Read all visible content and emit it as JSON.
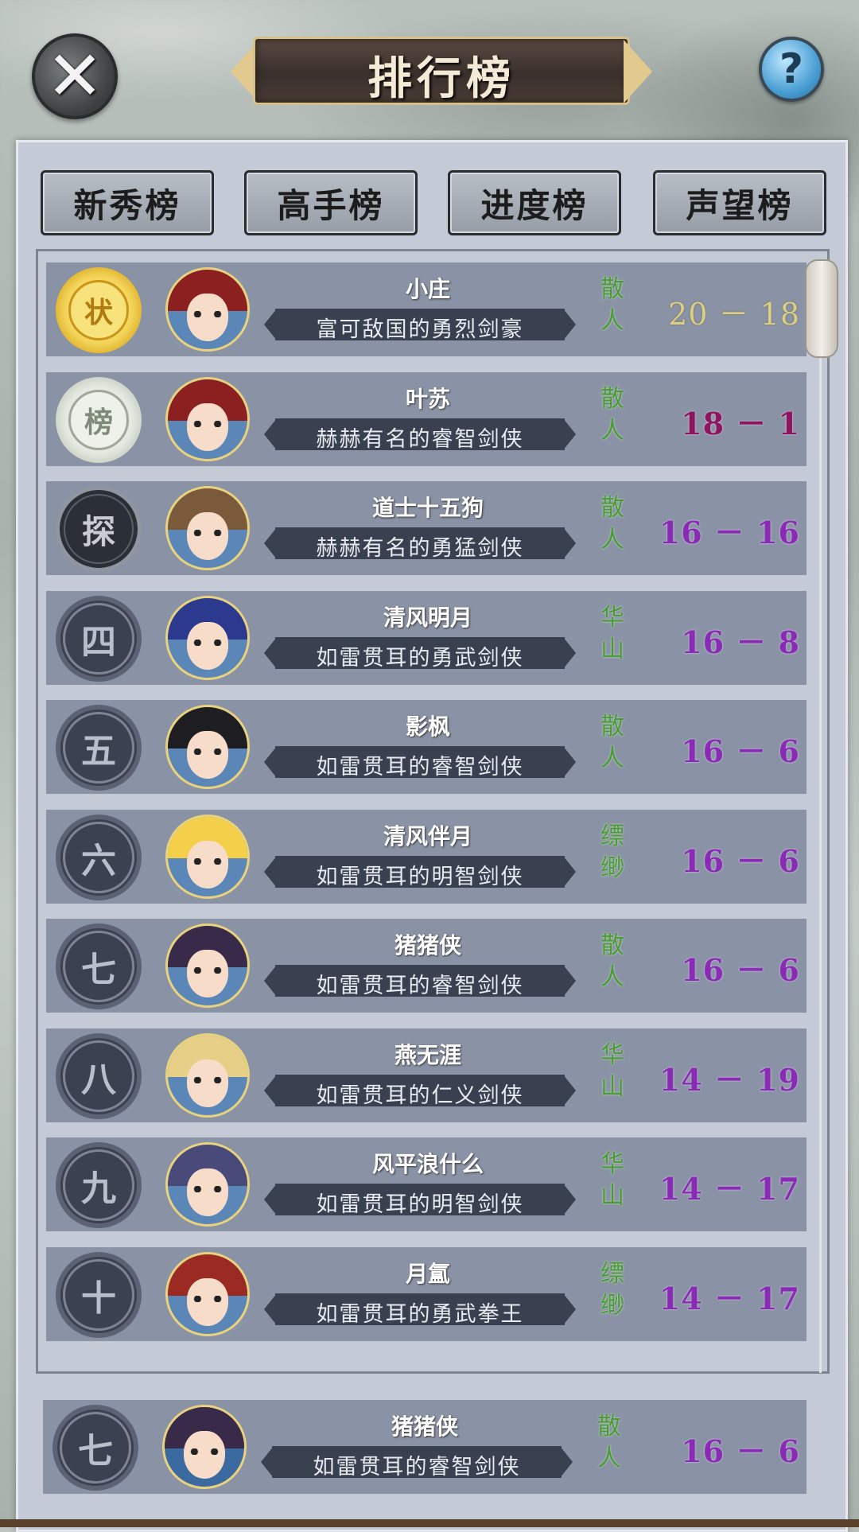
{
  "header": {
    "title": "排行榜",
    "close_icon": "close-icon",
    "help_label": "?"
  },
  "tabs": [
    {
      "label": "新秀榜"
    },
    {
      "label": "高手榜"
    },
    {
      "label": "进度榜"
    },
    {
      "label": "声望榜"
    }
  ],
  "rows": [
    {
      "rank": "状",
      "rank_style": "gold",
      "name": "小庄",
      "title": "富可敌国的勇烈剑豪",
      "faction": "散人",
      "score": "20 － 18",
      "score_style": "gold"
    },
    {
      "rank": "榜",
      "rank_style": "silver",
      "name": "叶苏",
      "title": "赫赫有名的睿智剑侠",
      "faction": "散人",
      "score": "18 － 1",
      "score_style": "crimson"
    },
    {
      "rank": "探",
      "rank_style": "dark",
      "name": "道士十五狗",
      "title": "赫赫有名的勇猛剑侠",
      "faction": "散人",
      "score": "16 － 16",
      "score_style": "purple"
    },
    {
      "rank": "四",
      "rank_style": "plain",
      "name": "清风明月",
      "title": "如雷贯耳的勇武剑侠",
      "faction": "华山",
      "score": "16 － 8",
      "score_style": "purple"
    },
    {
      "rank": "五",
      "rank_style": "plain",
      "name": "影枫",
      "title": "如雷贯耳的睿智剑侠",
      "faction": "散人",
      "score": "16 － 6",
      "score_style": "purple"
    },
    {
      "rank": "六",
      "rank_style": "plain",
      "name": "清风伴月",
      "title": "如雷贯耳的明智剑侠",
      "faction": "缥缈",
      "score": "16 － 6",
      "score_style": "purple"
    },
    {
      "rank": "七",
      "rank_style": "plain",
      "name": "猪猪侠",
      "title": "如雷贯耳的睿智剑侠",
      "faction": "散人",
      "score": "16 － 6",
      "score_style": "purple"
    },
    {
      "rank": "八",
      "rank_style": "plain",
      "name": "燕无涯",
      "title": "如雷贯耳的仁义剑侠",
      "faction": "华山",
      "score": "14 － 19",
      "score_style": "purple"
    },
    {
      "rank": "九",
      "rank_style": "plain",
      "name": "风平浪什么",
      "title": "如雷贯耳的明智剑侠",
      "faction": "华山",
      "score": "14 － 17",
      "score_style": "purple"
    },
    {
      "rank": "十",
      "rank_style": "plain",
      "name": "月氲",
      "title": "如雷贯耳的勇武拳王",
      "faction": "缥缈",
      "score": "14 － 17",
      "score_style": "purple"
    }
  ],
  "self_row": {
    "rank": "七",
    "name": "猪猪侠",
    "title": "如雷贯耳的睿智剑侠",
    "faction": "散人",
    "score": "16 － 6"
  },
  "avatar_colors": [
    "#8c1f1f",
    "#8c1f1f",
    "#7a5a3a",
    "#2b3a8f",
    "#1e1e22",
    "#f3cf4a",
    "#3a2a4a",
    "#e8cf88",
    "#4a4a7a",
    "#9a2a22"
  ]
}
